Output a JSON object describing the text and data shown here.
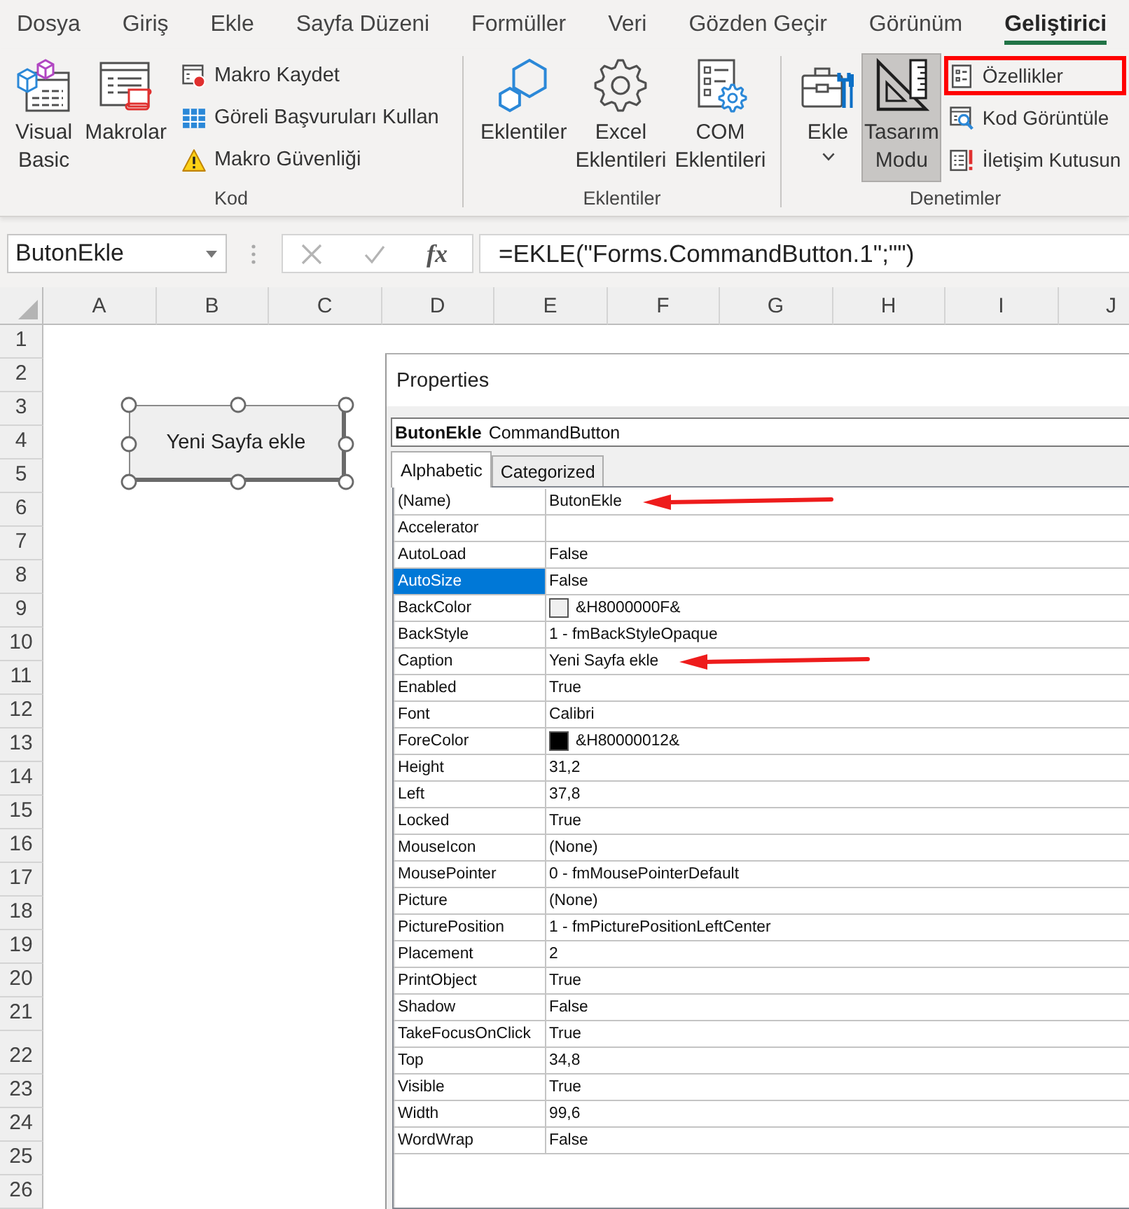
{
  "menu_tabs": [
    {
      "label": "Dosya",
      "selected": false
    },
    {
      "label": "Giriş",
      "selected": false
    },
    {
      "label": "Ekle",
      "selected": false
    },
    {
      "label": "Sayfa Düzeni",
      "selected": false
    },
    {
      "label": "Formüller",
      "selected": false
    },
    {
      "label": "Veri",
      "selected": false
    },
    {
      "label": "Gözden Geçir",
      "selected": false
    },
    {
      "label": "Görünüm",
      "selected": false
    },
    {
      "label": "Geliştirici",
      "selected": true
    }
  ],
  "ribbon_groups": [
    {
      "label": "Kod",
      "commands": [
        {
          "kind": "large",
          "label": "Visual Basic",
          "pressed": false,
          "highlighted": false
        },
        {
          "kind": "large",
          "label": "Makrolar",
          "pressed": false,
          "highlighted": false
        },
        {
          "kind": "small",
          "label": "Makro Kaydet",
          "pressed": false,
          "highlighted": false
        },
        {
          "kind": "small",
          "label": "Göreli Başvuruları Kullan",
          "pressed": false,
          "highlighted": false
        },
        {
          "kind": "small",
          "label": "Makro Güvenliği",
          "pressed": false,
          "highlighted": false
        }
      ]
    },
    {
      "label": "Eklentiler",
      "commands": [
        {
          "kind": "large",
          "label": "Eklentiler",
          "pressed": false,
          "highlighted": false
        },
        {
          "kind": "large",
          "label": "Excel Eklentileri",
          "pressed": false,
          "highlighted": false
        },
        {
          "kind": "large",
          "label": "COM Eklentileri",
          "pressed": false,
          "highlighted": false
        }
      ]
    },
    {
      "label": "Denetimler",
      "commands": [
        {
          "kind": "large",
          "label": "Ekle",
          "dropdown": true,
          "pressed": false,
          "highlighted": false
        },
        {
          "kind": "large",
          "label": "Tasarım Modu",
          "pressed": true,
          "highlighted": false
        },
        {
          "kind": "small",
          "label": "Özellikler",
          "pressed": false,
          "highlighted": true
        },
        {
          "kind": "small",
          "label": "Kod Görüntüle",
          "pressed": false,
          "highlighted": false
        },
        {
          "kind": "small",
          "label": "İletişim Kutusun",
          "pressed": false,
          "highlighted": false
        }
      ]
    }
  ],
  "formula_bar": {
    "name_box": "ButonEkle",
    "edit_buttons": [
      {
        "kind": "cancel",
        "disabled": true
      },
      {
        "kind": "enter",
        "disabled": true
      }
    ],
    "function_button": "fx",
    "formula": "=EKLE(\"Forms.CommandButton.1\";\"\")"
  },
  "sheet": {
    "columns": [
      "A",
      "B",
      "C",
      "D",
      "E",
      "F",
      "G",
      "H",
      "I",
      "J"
    ],
    "rows": [
      "1",
      "2",
      "3",
      "4",
      "5",
      "6",
      "7",
      "8",
      "9",
      "10",
      "11",
      "12",
      "13",
      "14",
      "15",
      "16",
      "17",
      "18",
      "19",
      "20",
      "21",
      "22",
      "23",
      "24",
      "25",
      "26"
    ],
    "control": {
      "caption": "Yeni Sayfa ekle",
      "selected": true
    }
  },
  "properties_window": {
    "title": "Properties",
    "object": {
      "name": "ButonEkle",
      "type": "CommandButton"
    },
    "tabs": [
      {
        "label": "Alphabetic",
        "selected": true
      },
      {
        "label": "Categorized",
        "selected": false
      }
    ],
    "properties": [
      {
        "name": "(Name)",
        "value": "ButonEkle",
        "selected": false,
        "arrow": true
      },
      {
        "name": "Accelerator",
        "selected": false
      },
      {
        "name": "AutoLoad",
        "value": "False",
        "selected": false
      },
      {
        "name": "AutoSize",
        "value": "False",
        "selected": true
      },
      {
        "name": "BackColor",
        "value": "&H8000000F&",
        "color": "#f0f0f0",
        "selected": false
      },
      {
        "name": "BackStyle",
        "value": "1 - fmBackStyleOpaque",
        "selected": false
      },
      {
        "name": "Caption",
        "value": "Yeni Sayfa ekle",
        "selected": false,
        "arrow": true
      },
      {
        "name": "Enabled",
        "value": "True",
        "selected": false
      },
      {
        "name": "Font",
        "value": "Calibri",
        "selected": false
      },
      {
        "name": "ForeColor",
        "value": "&H80000012&",
        "color": "#000000",
        "selected": false
      },
      {
        "name": "Height",
        "value": "31,2",
        "selected": false
      },
      {
        "name": "Left",
        "value": "37,8",
        "selected": false
      },
      {
        "name": "Locked",
        "value": "True",
        "selected": false
      },
      {
        "name": "MouseIcon",
        "value": "(None)",
        "selected": false
      },
      {
        "name": "MousePointer",
        "value": "0 - fmMousePointerDefault",
        "selected": false
      },
      {
        "name": "Picture",
        "value": "(None)",
        "selected": false
      },
      {
        "name": "PicturePosition",
        "value": "1 - fmPicturePositionLeftCenter",
        "selected": false
      },
      {
        "name": "Placement",
        "value": "2",
        "selected": false
      },
      {
        "name": "PrintObject",
        "value": "True",
        "selected": false
      },
      {
        "name": "Shadow",
        "value": "False",
        "selected": false
      },
      {
        "name": "TakeFocusOnClick",
        "value": "True",
        "selected": false
      },
      {
        "name": "Top",
        "value": "34,8",
        "selected": false
      },
      {
        "name": "Visible",
        "value": "True",
        "selected": false
      },
      {
        "name": "Width",
        "value": "99,6",
        "selected": false
      },
      {
        "name": "WordWrap",
        "value": "False",
        "selected": false
      }
    ]
  }
}
